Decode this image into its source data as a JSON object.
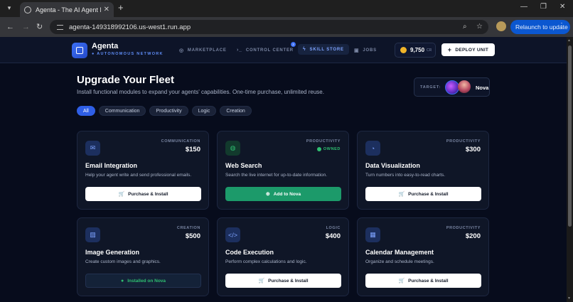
{
  "browser": {
    "tab_title": "Agenta - The AI Agent Marketp",
    "url": "agenta-149318992106.us-west1.run.app",
    "relaunch_label": "Relaunch to update"
  },
  "app": {
    "brand": "Agenta",
    "brand_sub": "AUTONOMOUS NETWORK",
    "nav": [
      {
        "label": "MARKETPLACE",
        "icon": "store-icon"
      },
      {
        "label": "CONTROL CENTER",
        "icon": "terminal-icon",
        "badge": "2"
      },
      {
        "label": "SKILL STORE",
        "icon": "bolt-icon",
        "active": true
      },
      {
        "label": "JOBS",
        "icon": "briefcase-icon"
      }
    ],
    "credits_value": "9,750",
    "credits_unit": "CR",
    "deploy_label": "DEPLOY UNIT"
  },
  "page": {
    "title": "Upgrade Your Fleet",
    "subtitle": "Install functional modules to expand your agents' capabilities. One-time purchase, unlimited reuse.",
    "target_label": "TARGET:",
    "target_name": "Nova",
    "filters": [
      "All",
      "Communication",
      "Productivity",
      "Logic",
      "Creation"
    ],
    "active_filter": "All"
  },
  "cards": [
    {
      "icon": "mail-icon",
      "category": "COMMUNICATION",
      "price": "$150",
      "title": "Email Integration",
      "desc": "Help your agent write and send professional emails.",
      "action": "Purchase & Install",
      "state": "buy"
    },
    {
      "icon": "globe-icon",
      "category": "PRODUCTIVITY",
      "price": "",
      "owned": "OWNED",
      "title": "Web Search",
      "desc": "Search the live internet for up-to-date information.",
      "action": "Add to Nova",
      "state": "add"
    },
    {
      "icon": "pie-chart-icon",
      "category": "PRODUCTIVITY",
      "price": "$300",
      "title": "Data Visualization",
      "desc": "Turn numbers into easy-to-read charts.",
      "action": "Purchase & Install",
      "state": "buy"
    },
    {
      "icon": "image-icon",
      "category": "CREATION",
      "price": "$500",
      "title": "Image Generation",
      "desc": "Create custom images and graphics.",
      "action": "Installed on Nova",
      "state": "installed"
    },
    {
      "icon": "code-icon",
      "category": "LOGIC",
      "price": "$400",
      "title": "Code Execution",
      "desc": "Perform complex calculations and logic.",
      "action": "Purchase & Install",
      "state": "buy"
    },
    {
      "icon": "calendar-icon",
      "category": "PRODUCTIVITY",
      "price": "$200",
      "title": "Calendar Management",
      "desc": "Organize and schedule meetings.",
      "action": "Purchase & Install",
      "state": "buy"
    }
  ],
  "colors": {
    "accent": "#2f5fe6",
    "success": "#1c9a6a",
    "background": "#070c1c"
  }
}
